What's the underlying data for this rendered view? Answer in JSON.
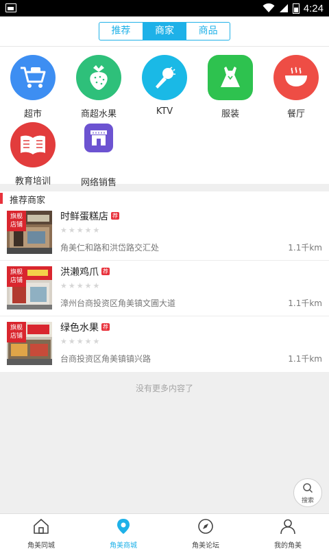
{
  "status_bar": {
    "time": "4:24"
  },
  "segments": [
    {
      "label": "推荐",
      "active": false
    },
    {
      "label": "商家",
      "active": true
    },
    {
      "label": "商品",
      "active": false
    }
  ],
  "categories": [
    {
      "label": "超市",
      "icon": "shopping-cart-icon",
      "color": "#3d8ef2"
    },
    {
      "label": "商超水果",
      "icon": "strawberry-icon",
      "color": "#2ec07a"
    },
    {
      "label": "KTV",
      "icon": "microphone-icon",
      "color": "#1ab9e6"
    },
    {
      "label": "服装",
      "icon": "dress-icon",
      "color": "#2ec24f"
    },
    {
      "label": "餐厅",
      "icon": "bowl-icon",
      "color": "#ee4d45"
    },
    {
      "label": "教育培训",
      "icon": "book-icon",
      "color": "#e23c3c"
    },
    {
      "label": "网络销售",
      "icon": "storefront-icon",
      "color": "#6c53d1"
    }
  ],
  "section_title": "推荐商家",
  "merchants": [
    {
      "name": "时鲜蛋糕店",
      "badge": "荐",
      "address": "角美仁和路和洪岱路交汇处",
      "distance": "1.1千km",
      "ribbon": "旗舰店铺",
      "rating_stars": 5
    },
    {
      "name": "洪濑鸡爪",
      "badge": "荐",
      "address": "漳州台商投资区角美镇文圃大道",
      "distance": "1.1千km",
      "ribbon": "旗舰店铺",
      "rating_stars": 5
    },
    {
      "name": "绿色水果",
      "badge": "荐",
      "address": "台商投资区角美镇镇兴路",
      "distance": "1.1千km",
      "ribbon": "旗舰店铺",
      "rating_stars": 5
    }
  ],
  "no_more_text": "没有更多内容了",
  "search_label": "搜索",
  "tabs": [
    {
      "label": "角美同城",
      "icon": "home-icon",
      "active": false
    },
    {
      "label": "角美商城",
      "icon": "map-pin-icon",
      "active": true
    },
    {
      "label": "角美论坛",
      "icon": "compass-icon",
      "active": false
    },
    {
      "label": "我的角美",
      "icon": "user-icon",
      "active": false
    }
  ],
  "colors": {
    "accent": "#1eb1e8",
    "highlight": "#e8323c"
  }
}
